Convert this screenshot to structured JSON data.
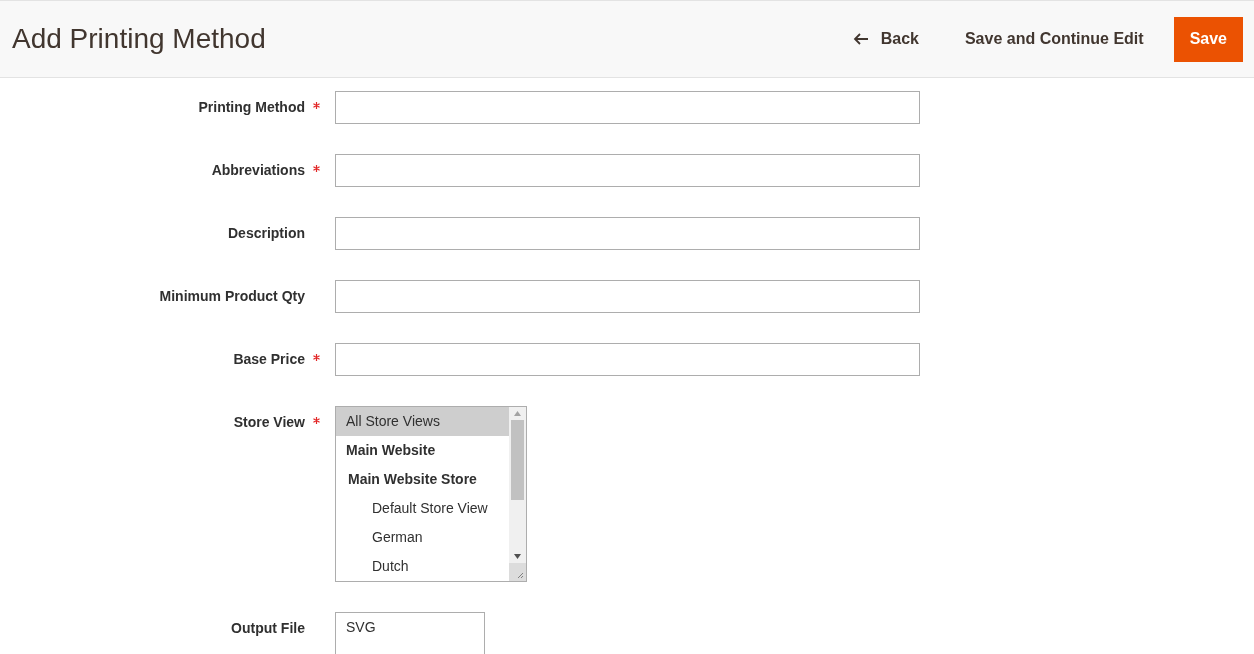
{
  "header": {
    "title": "Add Printing Method",
    "back": "Back",
    "save_continue": "Save and Continue Edit",
    "save": "Save"
  },
  "fields": [
    {
      "label": "Printing Method",
      "required": true,
      "kind": "text"
    },
    {
      "label": "Abbreviations",
      "required": true,
      "kind": "text"
    },
    {
      "label": "Description",
      "required": false,
      "kind": "text"
    },
    {
      "label": "Minimum Product Qty",
      "required": false,
      "kind": "text"
    },
    {
      "label": "Base Price",
      "required": true,
      "kind": "text"
    },
    {
      "label": "Store View",
      "required": true,
      "kind": "multiselect",
      "options": [
        {
          "label": "All Store Views",
          "kind": "option",
          "selected": true
        },
        {
          "label": "Main Website",
          "kind": "group",
          "selected": false,
          "children": [
            {
              "label": "Main Website Store",
              "kind": "group",
              "selected": false,
              "children": [
                {
                  "label": "Default Store View",
                  "kind": "option",
                  "selected": false
                },
                {
                  "label": "German",
                  "kind": "option",
                  "selected": false
                },
                {
                  "label": "Dutch",
                  "kind": "option",
                  "selected": false
                }
              ]
            }
          ]
        }
      ]
    },
    {
      "label": "Output File",
      "required": false,
      "kind": "list",
      "options": [
        {
          "label": "SVG",
          "selected": false
        }
      ]
    }
  ]
}
